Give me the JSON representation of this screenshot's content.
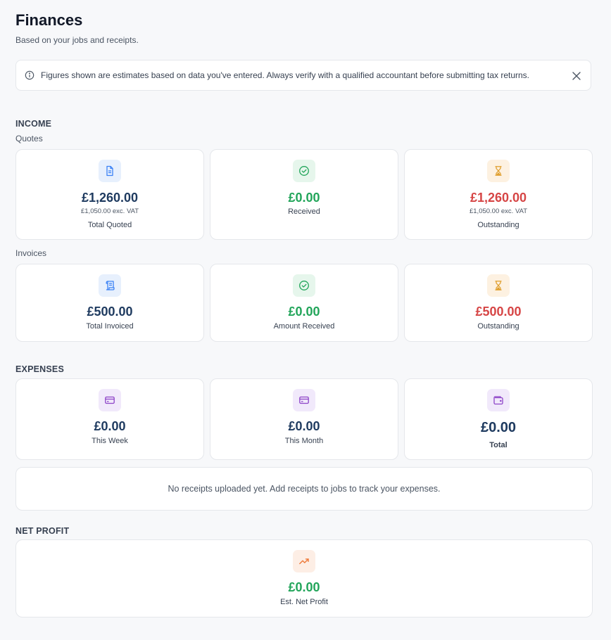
{
  "header": {
    "title": "Finances",
    "subtitle": "Based on your jobs and receipts."
  },
  "notice": {
    "icon": "info-icon",
    "text": "Figures shown are estimates based on data you've entered. Always verify with a qualified accountant before submitting tax returns.",
    "close_icon": "close-icon"
  },
  "income": {
    "heading": "INCOME",
    "quotes": {
      "heading": "Quotes",
      "total": {
        "icon": "document-icon",
        "amount": "£1,260.00",
        "exvat": "£1,050.00 exc. VAT",
        "label": "Total Quoted"
      },
      "received": {
        "icon": "check-circle-icon",
        "amount": "£0.00",
        "label": "Received"
      },
      "outstanding": {
        "icon": "hourglass-icon",
        "amount": "£1,260.00",
        "exvat": "£1,050.00 exc. VAT",
        "label": "Outstanding"
      }
    },
    "invoices": {
      "heading": "Invoices",
      "total": {
        "icon": "invoice-icon",
        "amount": "£500.00",
        "label": "Total Invoiced"
      },
      "received": {
        "icon": "check-circle-icon",
        "amount": "£0.00",
        "label": "Amount Received"
      },
      "outstanding": {
        "icon": "hourglass-icon",
        "amount": "£500.00",
        "label": "Outstanding"
      }
    }
  },
  "expenses": {
    "heading": "EXPENSES",
    "week": {
      "icon": "credit-card-icon",
      "amount": "£0.00",
      "label": "This Week"
    },
    "month": {
      "icon": "credit-card-icon",
      "amount": "£0.00",
      "label": "This Month"
    },
    "total": {
      "icon": "wallet-icon",
      "amount": "£0.00",
      "label": "Total"
    },
    "empty_message": "No receipts uploaded yet. Add receipts to jobs to track your expenses."
  },
  "net_profit": {
    "heading": "NET PROFIT",
    "icon": "trending-up-icon",
    "amount": "£0.00",
    "label": "Est. Net Profit"
  },
  "colors": {
    "navy": "#1e3a5f",
    "green": "#22a55a",
    "red": "#d64545",
    "amber": "#e0a030",
    "purple": "#8e44c8",
    "orange": "#ee7a3a",
    "blue": "#3b82f6"
  }
}
